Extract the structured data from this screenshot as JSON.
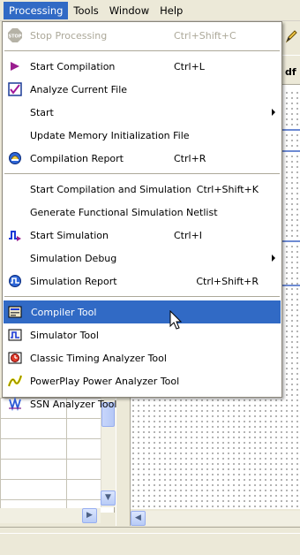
{
  "menubar": {
    "items": [
      {
        "label": "Processing",
        "active": true
      },
      {
        "label": "Tools"
      },
      {
        "label": "Window"
      },
      {
        "label": "Help"
      }
    ]
  },
  "background": {
    "column_header": "df"
  },
  "menu": {
    "stop_processing": {
      "label": "Stop Processing",
      "accel": "Ctrl+Shift+C",
      "icon": "stop-icon",
      "disabled": true
    },
    "start_compilation": {
      "label": "Start Compilation",
      "accel": "Ctrl+L",
      "icon": "play-icon"
    },
    "analyze_current_file": {
      "label": "Analyze Current File",
      "icon": "analyze-icon"
    },
    "start": {
      "label": "Start"
    },
    "update_memory_init": {
      "label": "Update Memory Initialization File"
    },
    "compilation_report": {
      "label": "Compilation Report",
      "accel": "Ctrl+R",
      "icon": "report-icon"
    },
    "start_comp_sim": {
      "label": "Start Compilation and Simulation",
      "accel": "Ctrl+Shift+K"
    },
    "generate_func_sim": {
      "label": "Generate Functional Simulation Netlist"
    },
    "start_simulation": {
      "label": "Start Simulation",
      "accel": "Ctrl+I",
      "icon": "simulation-icon"
    },
    "simulation_debug": {
      "label": "Simulation Debug"
    },
    "simulation_report": {
      "label": "Simulation Report",
      "accel": "Ctrl+Shift+R",
      "icon": "sim-report-icon"
    },
    "compiler_tool": {
      "label": "Compiler Tool",
      "icon": "compiler-tool-icon",
      "highlighted": true
    },
    "simulator_tool": {
      "label": "Simulator Tool",
      "icon": "simulator-tool-icon"
    },
    "classic_timing": {
      "label": "Classic Timing Analyzer Tool",
      "icon": "timing-analyzer-icon"
    },
    "powerplay": {
      "label": "PowerPlay Power Analyzer Tool",
      "icon": "power-analyzer-icon"
    },
    "ssn_analyzer": {
      "label": "SSN Analyzer Tool",
      "icon": "ssn-analyzer-icon"
    }
  },
  "colors": {
    "highlight": "#316ac5",
    "menu_bg": "#ffffff",
    "chrome": "#ece9d8"
  }
}
